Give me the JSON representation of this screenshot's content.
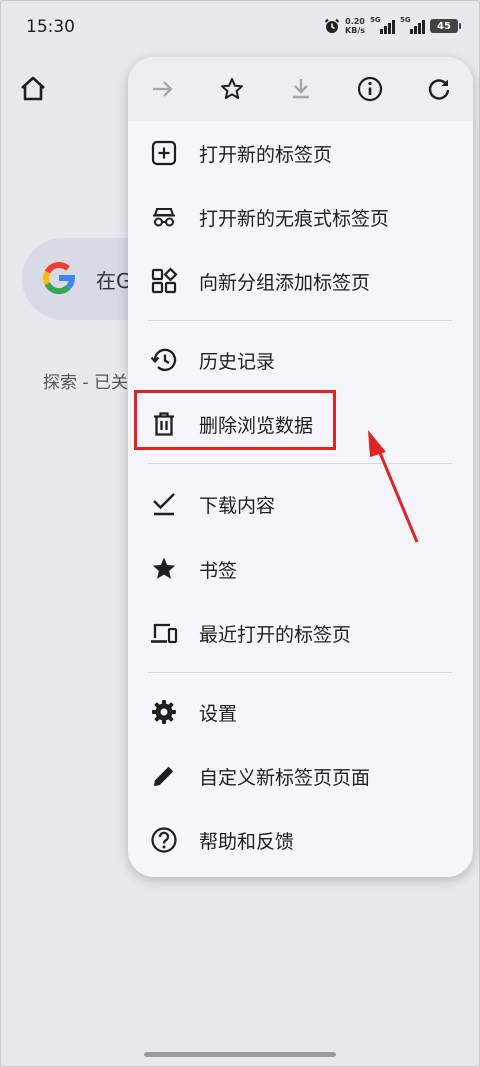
{
  "status_bar": {
    "time": "15:30",
    "net_speed_value": "0.20",
    "net_speed_unit": "KB/s",
    "sim1": "5G",
    "sim2": "5G",
    "battery": "45"
  },
  "page": {
    "search_text": "在G",
    "explore_text": "探索 - 已关"
  },
  "menu": {
    "toolbar": [
      "forward-icon",
      "star-icon",
      "download-icon",
      "info-icon",
      "refresh-icon"
    ],
    "items": [
      {
        "label": "打开新的标签页",
        "icon": "new-tab-icon"
      },
      {
        "label": "打开新的无痕式标签页",
        "icon": "incognito-icon"
      },
      {
        "label": "向新分组添加标签页",
        "icon": "tab-group-icon"
      },
      {
        "label": "历史记录",
        "icon": "history-icon"
      },
      {
        "label": "删除浏览数据",
        "icon": "trash-icon"
      },
      {
        "label": "下载内容",
        "icon": "downloads-icon"
      },
      {
        "label": "书签",
        "icon": "bookmark-star-icon"
      },
      {
        "label": "最近打开的标签页",
        "icon": "devices-icon"
      },
      {
        "label": "设置",
        "icon": "settings-gear-icon"
      },
      {
        "label": "自定义新标签页页面",
        "icon": "pencil-icon"
      },
      {
        "label": "帮助和反馈",
        "icon": "help-icon"
      }
    ]
  },
  "colors": {
    "highlight": "#e02424",
    "menu_bg": "#f6f5fb",
    "page_bg": "#e9e8ef"
  }
}
